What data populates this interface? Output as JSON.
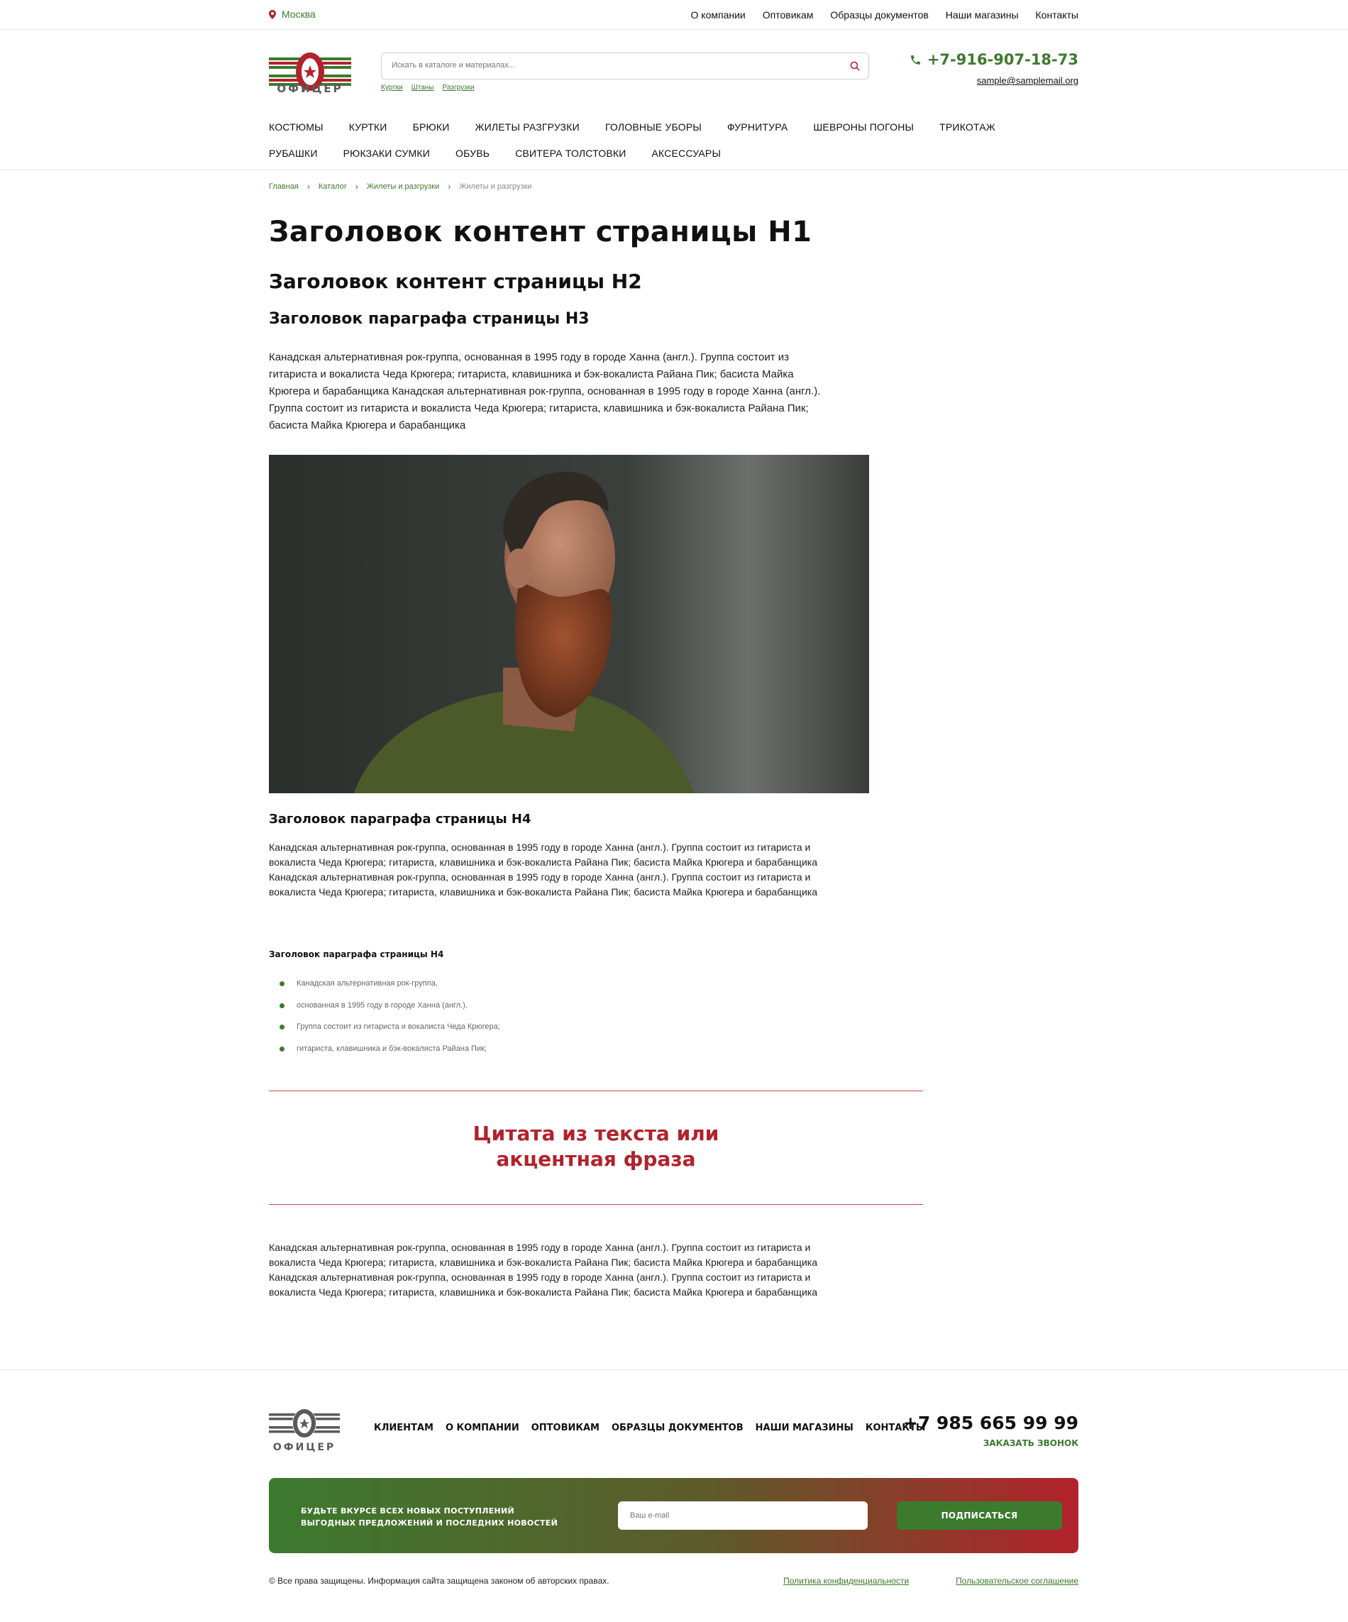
{
  "topbar": {
    "city": "Москва",
    "nav": [
      "О компании",
      "Оптовикам",
      "Образцы документов",
      "Наши магазины",
      "Контакты"
    ]
  },
  "header": {
    "logo_text": "ОФИЦЕР",
    "search_placeholder": "Искать в каталоге и материалах...",
    "search_hints": [
      "Куртки",
      "Штаны",
      "Разгрузки"
    ],
    "phone": "+7-916-907-18-73",
    "email": "sample@samplemail.org",
    "catalog_row1": [
      "КОСТЮМЫ",
      "КУРТКИ",
      "БРЮКИ",
      "ЖИЛЕТЫ РАЗГРУЗКИ",
      "ГОЛОВНЫЕ УБОРЫ",
      "ФУРНИТУРА",
      "ШЕВРОНЫ ПОГОНЫ",
      "ТРИКОТАЖ"
    ],
    "catalog_row2": [
      "РУБАШКИ",
      "РЮКЗАКИ СУМКИ",
      "ОБУВЬ",
      "СВИТЕРА ТОЛСТОВКИ",
      "АКСЕССУАРЫ"
    ]
  },
  "breadcrumbs": [
    "Главная",
    "Каталог",
    "Жилеты и разгрузки",
    "Жилеты и разгрузки"
  ],
  "content": {
    "h1": "Заголовок контент страницы H1",
    "h2": "Заголовок контент страницы H2",
    "h3": "Заголовок параграфа страницы H3",
    "p1": "Канадская альтернативная рок-группа, основанная в 1995 году в городе Ханна (англ.). Группа состоит из гитариста и вокалиста Чеда Крюгера; гитариста, клавишника и бэк-вокалиста Райана Пик; басиста Майка Крюгера и барабанщика Канадская альтернативная рок-группа, основанная в 1995 году в городе Ханна (англ.). Группа состоит из гитариста и вокалиста Чеда Крюгера; гитариста, клавишника и бэк-вокалиста Райана Пик; басиста Майка Крюгера и барабанщика",
    "h4": "Заголовок параграфа страницы H4",
    "p2": "Канадская альтернативная рок-группа, основанная в 1995 году в городе Ханна (англ.). Группа состоит из гитариста и вокалиста Чеда Крюгера; гитариста, клавишника и бэк-вокалиста Райана Пик; басиста Майка Крюгера и барабанщика Канадская альтернативная рок-группа, основанная в 1995 году в городе Ханна (англ.). Группа состоит из гитариста и вокалиста Чеда Крюгера; гитариста, клавишника и бэк-вокалиста Райана Пик; басиста Майка Крюгера и барабанщика",
    "h4_small": "Заголовок параграфа страницы H4",
    "list": [
      "Канадская альтернативная рок-группа,",
      "основанная в 1995 году в городе Ханна (англ.).",
      "Группа состоит из гитариста и вокалиста Чеда Крюгера;",
      "гитариста, клавишника и бэк-вокалиста Райана Пик;"
    ],
    "quote_line1": "Цитата из текста или",
    "quote_line2": "акцентная фраза",
    "p3": "Канадская альтернативная рок-группа, основанная в 1995 году в городе Ханна (англ.). Группа состоит из гитариста и вокалиста Чеда Крюгера; гитариста, клавишника и бэк-вокалиста Райана Пик; басиста Майка Крюгера и барабанщика Канадская альтернативная рок-группа, основанная в 1995 году в городе Ханна (англ.). Группа состоит из гитариста и вокалиста Чеда Крюгера; гитариста, клавишника и бэк-вокалиста Райана Пик; басиста Майка Крюгера и барабанщика"
  },
  "footer": {
    "logo_text": "ОФИЦЕР",
    "nav": [
      "КЛИЕНТАМ",
      "О КОМПАНИИ",
      "ОПТОВИКАМ",
      "ОБРАЗЦЫ ДОКУМЕНТОВ",
      "НАШИ МАГАЗИНЫ",
      "КОНТАКТЫ"
    ],
    "phone": "+7 985 665 99 99",
    "call_label": "ЗАКАЗАТЬ ЗВОНОК",
    "subscribe_line1": "БУДЬТЕ ВКУРСЕ ВСЕХ НОВЫХ ПОСТУПЛЕНИЙ",
    "subscribe_line2": "ВЫГОДНЫХ ПРЕДЛОЖЕНИЙ И ПОСЛЕДНИХ НОВОСТЕЙ",
    "email_placeholder": "Ваш e-mail",
    "subscribe_button": "ПОДПИСАТЬСЯ",
    "copyright": "© Все права защищены. Информация сайта защищена законом об авторских правах.",
    "privacy": "Политика конфиденциальности",
    "agreement": "Пользовательское соглашение"
  },
  "colors": {
    "brand_green": "#3c7a2e",
    "brand_red": "#b2222b"
  },
  "icons": {
    "city": "location-pin-icon",
    "search": "search-icon",
    "phone": "phone-icon",
    "list_bullet": "bullet-dot-icon"
  }
}
